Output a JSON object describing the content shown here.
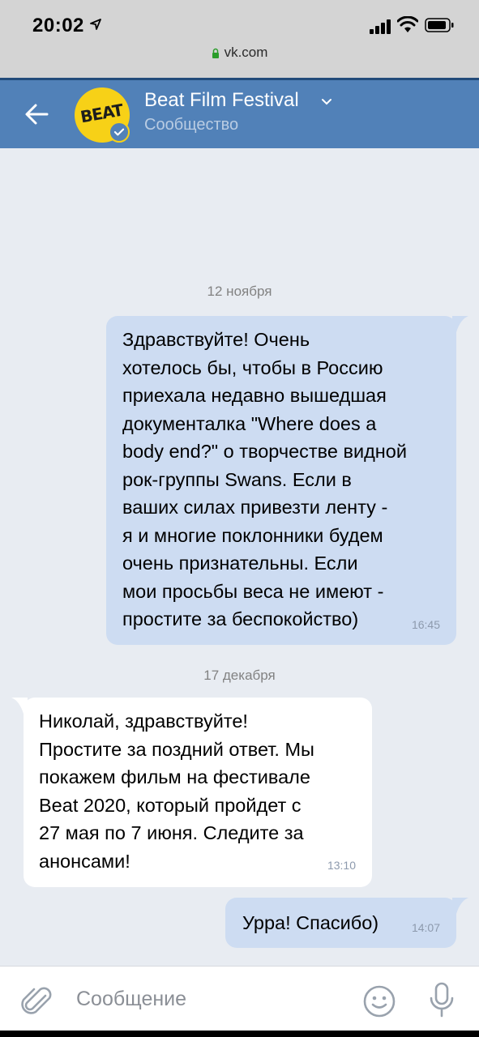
{
  "status_bar": {
    "time": "20:02",
    "url": "vk.com"
  },
  "header": {
    "title": "Beat Film Festival",
    "subtitle": "Сообщество",
    "avatar_text": "BEAT",
    "header_color": "#5181b8"
  },
  "messages": [
    {
      "date": "12 ноября"
    },
    {
      "direction": "out",
      "lines": [
        "Здравствуйте! Очень",
        "хотелось бы, чтобы в Россию",
        "приехала недавно вышедшая",
        "документалка \"Where does a",
        "body end?\" о творчестве видной",
        "рок-группы Swans. Если в",
        "ваших силах привезти ленту -",
        "я и многие поклонники будем",
        "очень признательны. Если",
        "мои просьбы веса не имеют -",
        "простите за беспокойство)"
      ],
      "time": "16:45"
    },
    {
      "date": "17 декабря"
    },
    {
      "direction": "in",
      "lines": [
        "Николай, здравствуйте!",
        "Простите за поздний ответ. Мы",
        "покажем фильм на фестивале",
        "Beat 2020, который пройдет с",
        "27 мая по 7 июня. Следите за",
        "анонсами!"
      ],
      "time": "13:10"
    },
    {
      "direction": "out",
      "lines": [
        "Урра! Спасибо)"
      ],
      "time": "14:07"
    }
  ],
  "composer": {
    "placeholder": "Сообщение"
  },
  "colors": {
    "outgoing_bubble": "#cddcf2",
    "incoming_bubble": "#ffffff",
    "background": "#e8ecf2"
  }
}
